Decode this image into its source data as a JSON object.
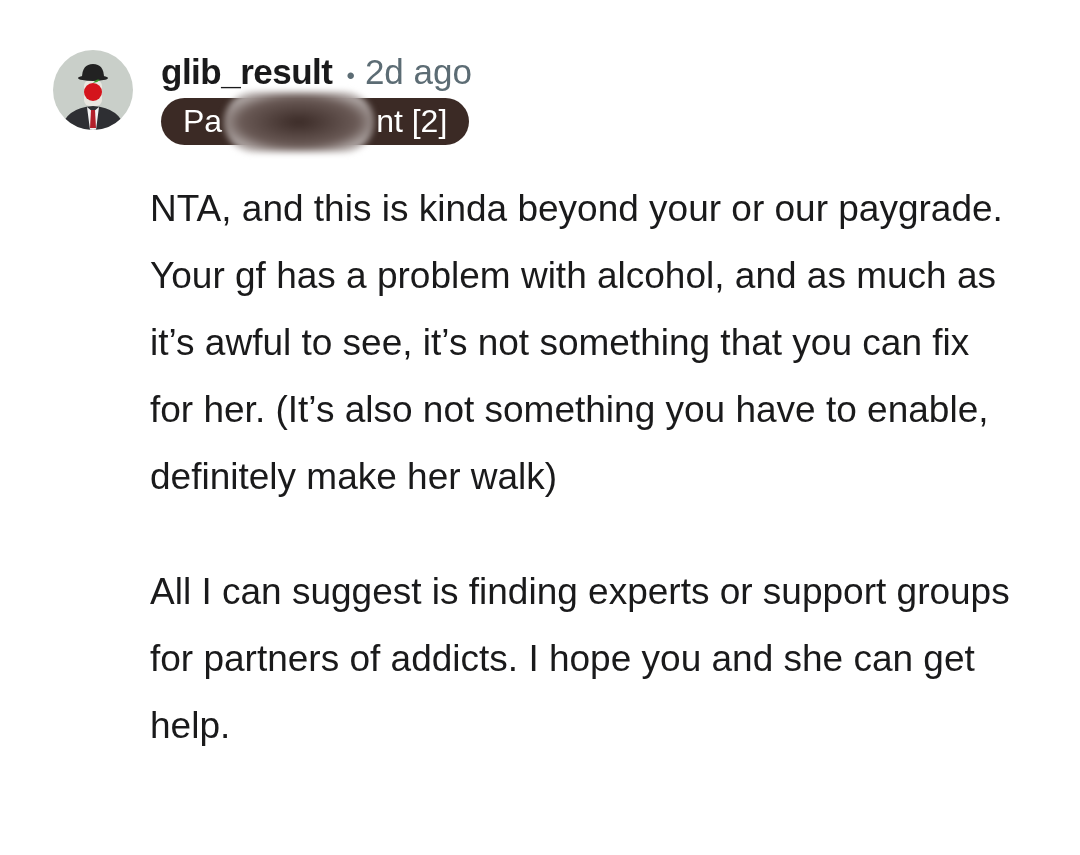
{
  "comment": {
    "author": "glib_result",
    "separator": "•",
    "time": "2d ago",
    "flair": {
      "visible_start": "Pa",
      "visible_end": "nt [2]",
      "redacted": true
    },
    "paragraphs": [
      "NTA, and this is kinda beyond your or our paygrade. Your gf has a problem with alcohol, and as much as it’s awful to see, it’s not something that you can fix for her. (It’s also not something you have to enable, definitely make her walk)",
      "All I can suggest is finding experts or support groups for partners of addicts. I hope you and she can get help."
    ]
  }
}
